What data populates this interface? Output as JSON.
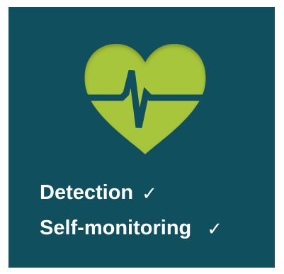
{
  "tile": {
    "background": "#0f4f5e",
    "heart_color": "#a8c63a",
    "icon": "heart-pulse-icon"
  },
  "features": [
    {
      "label": "Detection",
      "check": "✓",
      "check_icon": "check-icon"
    },
    {
      "label": "Self-monitoring",
      "check": "✓",
      "check_icon": "check-icon"
    }
  ]
}
